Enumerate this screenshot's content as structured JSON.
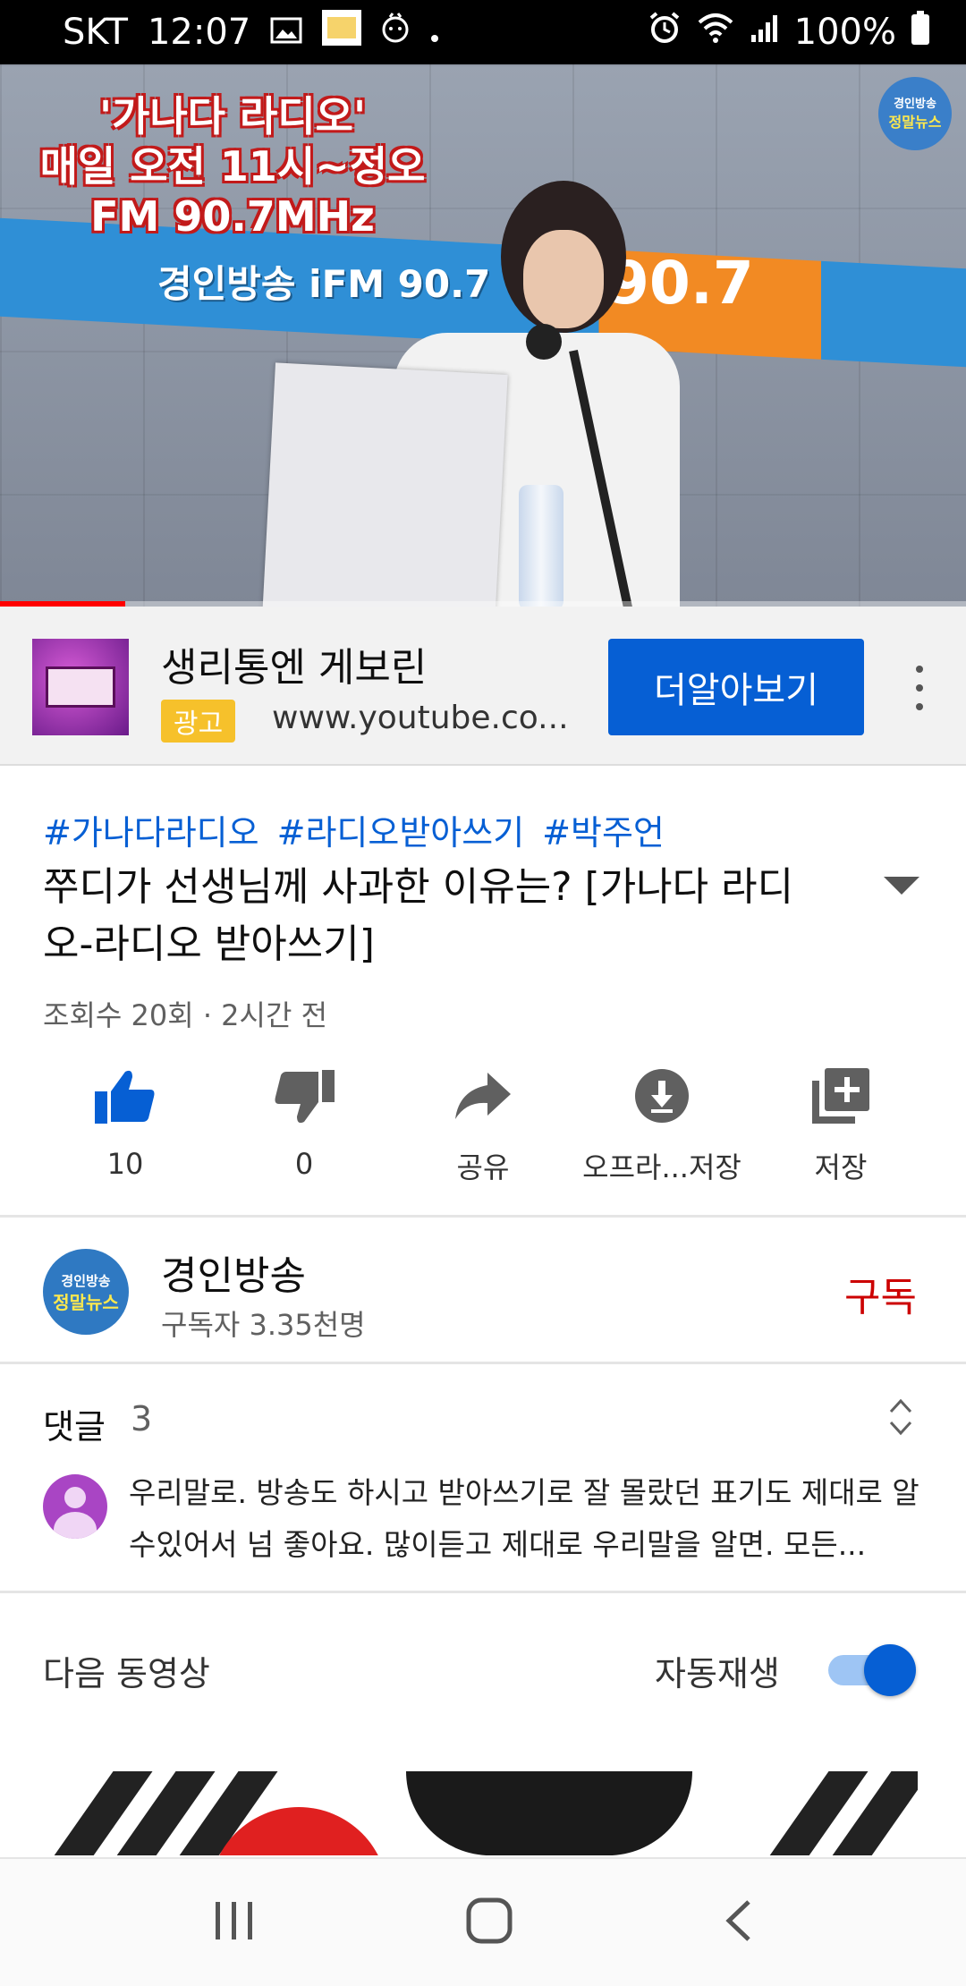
{
  "status_bar": {
    "carrier": "SKT",
    "time": "12:07",
    "battery": "100%",
    "notification_icons": [
      "image-icon",
      "app-icon",
      "alarm-app-icon",
      "dot-icon"
    ],
    "system_icons": [
      "alarm-icon",
      "wifi-icon",
      "signal-icon",
      "battery-icon"
    ]
  },
  "video": {
    "overlay_line1": "'가나다 라디오'",
    "overlay_line2": "매일 오전 11시~정오",
    "overlay_line3": "FM 90.7MHz",
    "backdrop_text": "경인방송 iFM 90.7",
    "backdrop_freq": "90.7",
    "channel_logo_top": "경인방송",
    "channel_logo_bottom": "정말뉴스",
    "progress": 0.13
  },
  "ad": {
    "title": "생리통엔 게보린",
    "badge": "광고",
    "url": "www.youtube.co...",
    "cta_label": "더알아보기"
  },
  "video_info": {
    "hashtags": [
      "#가나다라디오",
      "#라디오받아쓰기",
      "#박주언"
    ],
    "title": "쭈디가 선생님께 사과한 이유는? [가나다 라디오-라디오 받아쓰기]",
    "meta": "조회수 20회 · 2시간 전"
  },
  "actions": [
    {
      "icon": "thumbs-up-icon",
      "label": "10"
    },
    {
      "icon": "thumbs-down-icon",
      "label": "0"
    },
    {
      "icon": "share-icon",
      "label": "공유"
    },
    {
      "icon": "download-icon",
      "label": "오프라...저장"
    },
    {
      "icon": "playlist-add-icon",
      "label": "저장"
    }
  ],
  "channel": {
    "name": "경인방송",
    "subscribers": "구독자 3.35천명",
    "subscribe_label": "구독",
    "avatar_top": "경인방송",
    "avatar_bottom": "정말뉴스"
  },
  "comments": {
    "title": "댓글",
    "count": "3",
    "top_comment": "우리말로. 방송도 하시고 받아쓰기로 잘 몰랐던 표기도 제대로 알수있어서 넘 좋아요. 많이듣고 제대로 우리말을 알면. 모든..."
  },
  "up_next": {
    "label": "다음 동영상",
    "autoplay_label": "자동재생",
    "autoplay_on": true
  },
  "colors": {
    "accent_blue": "#065fd4",
    "subscribe_red": "#cc0000",
    "ad_badge": "#f6c12b"
  }
}
